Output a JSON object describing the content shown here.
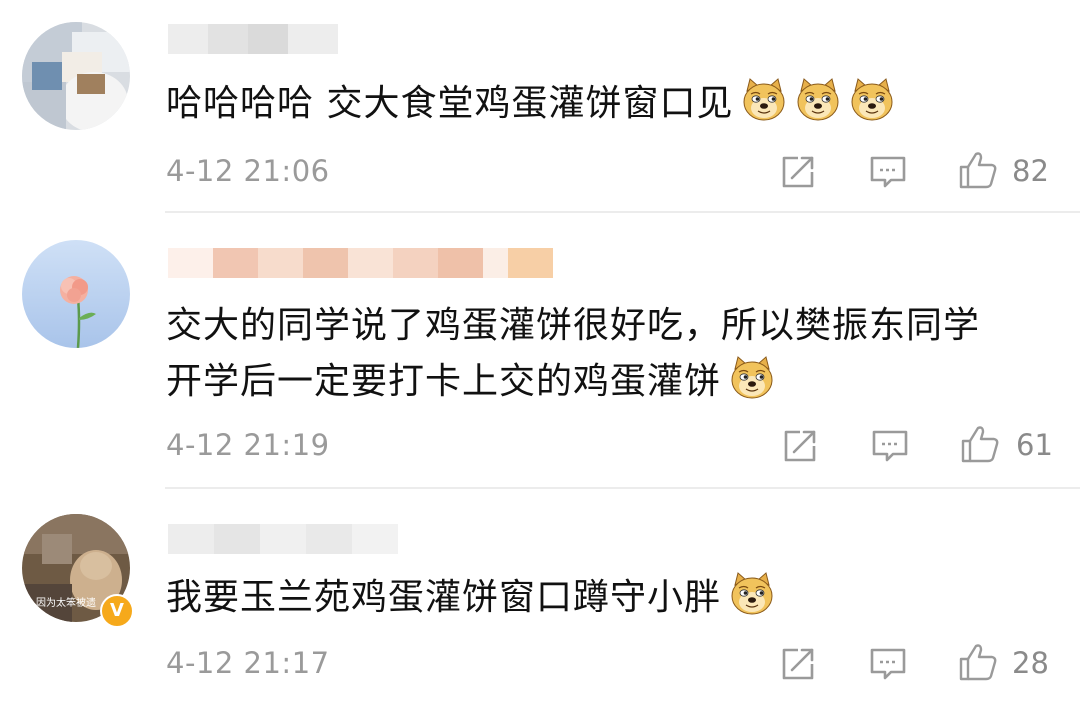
{
  "comments": [
    {
      "text_lines": [
        "哈哈哈哈 交大食堂鸡蛋灌饼窗口见"
      ],
      "emoji_count": 3,
      "time": "4-12 21:06",
      "likes": "82",
      "avatar": "avatar-photo-person"
    },
    {
      "text_lines": [
        "交大的同学说了鸡蛋灌饼很好吃，所以樊振东同学",
        "开学后一定要打卡上交的鸡蛋灌饼"
      ],
      "emoji_count": 1,
      "time": "4-12 21:19",
      "likes": "61",
      "avatar": "avatar-photo-flower"
    },
    {
      "text_lines": [
        "我要玉兰苑鸡蛋灌饼窗口蹲守小胖"
      ],
      "emoji_count": 1,
      "time": "4-12 21:17",
      "likes": "28",
      "avatar": "avatar-photo-dog",
      "avatar_caption": "因为太笨被遗",
      "verified_badge": "V"
    }
  ],
  "icons": {
    "share": "share-icon",
    "reply": "comment-icon",
    "like": "thumbs-up-icon",
    "emoji": "doge-emoji-icon"
  },
  "colors": {
    "text": "#111111",
    "meta": "#9a9a9a",
    "divider": "#ececec",
    "badge": "#f6a91b"
  }
}
